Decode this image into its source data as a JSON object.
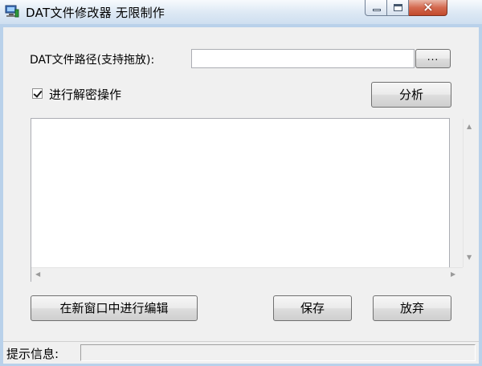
{
  "window": {
    "title": "DAT文件修改器  无限制作",
    "icon": "computer-icon",
    "controls": {
      "minimize": "minimize-icon",
      "maximize": "maximize-icon",
      "close": "×"
    }
  },
  "form": {
    "path_label": "DAT文件路径(支持拖放):",
    "path_value": "",
    "browse_label": "...",
    "decrypt_label": "进行解密操作",
    "decrypt_checked": true,
    "analyze_label": "分析"
  },
  "editor": {
    "content": "",
    "scroll_up": "▲",
    "scroll_down": "▼",
    "scroll_left": "◀",
    "scroll_right": "▶"
  },
  "actions": {
    "edit_in_new_window": "在新窗口中进行编辑",
    "save": "保存",
    "discard": "放弃"
  },
  "status": {
    "label": "提示信息:",
    "message": ""
  },
  "colors": {
    "titlebar": "#dce8f4",
    "close_button": "#c24a2c",
    "dialog_bg": "#f0f0f0"
  }
}
